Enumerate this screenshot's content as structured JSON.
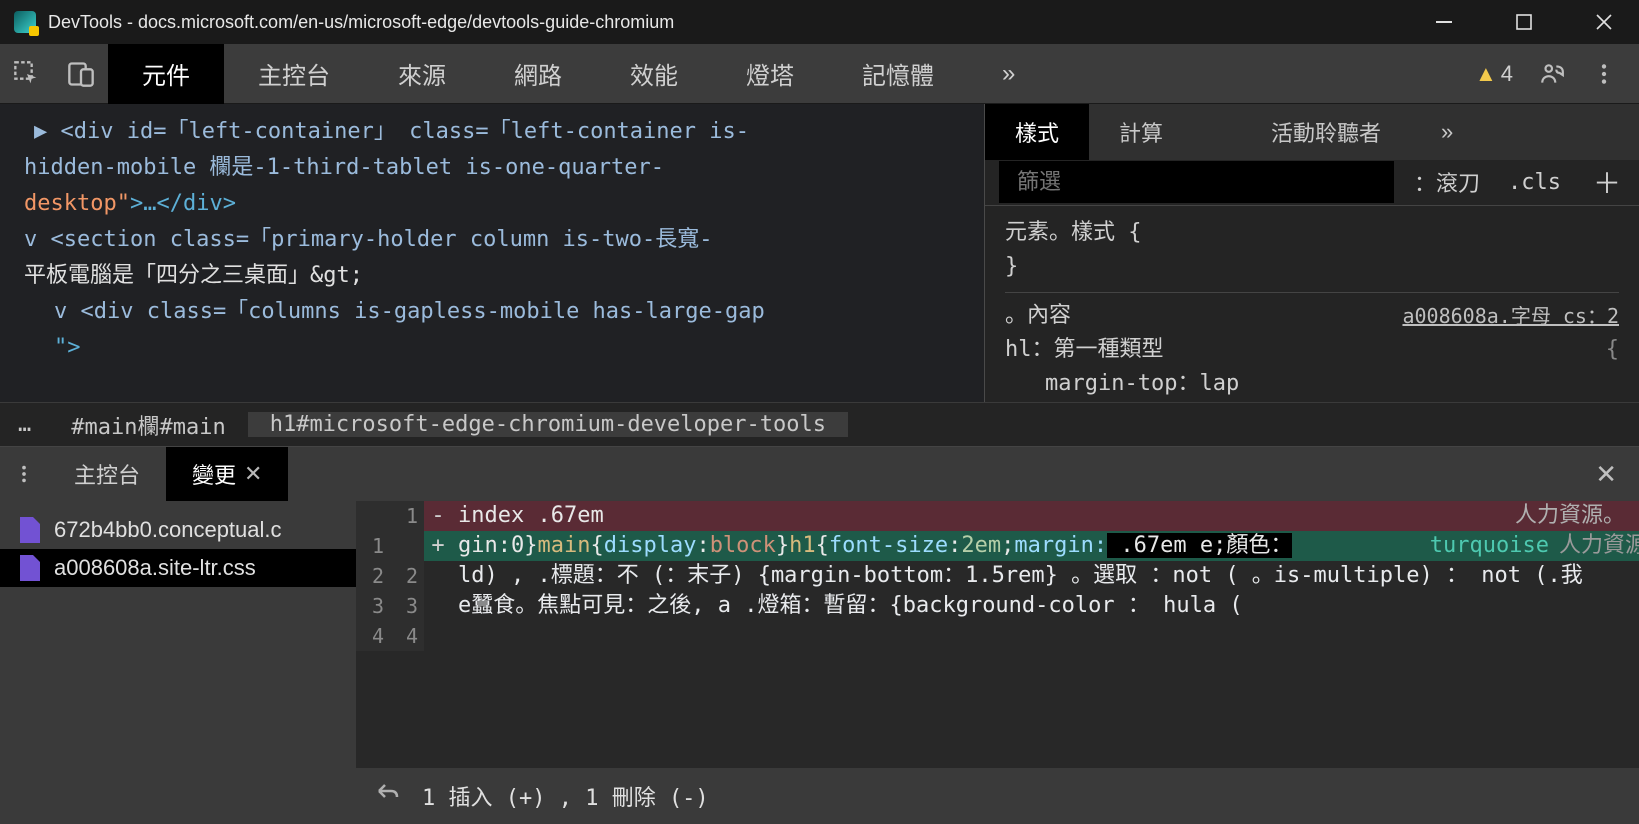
{
  "window": {
    "title": "DevTools - docs.microsoft.com/en-us/microsoft-edge/devtools-guide-chromium"
  },
  "toolbar": {
    "tabs": [
      "元件",
      "主控台",
      "來源",
      "網路",
      "效能",
      "燈塔",
      "記憶體"
    ],
    "more": "»",
    "warning_count": "4"
  },
  "elements": {
    "line1a": "▶ <div id=「left-container」 class=「left-container is-",
    "line1b": "hidden-mobile 欄是-1-third-tablet is-one-quarter-",
    "line1c_val": "desktop\"",
    "line1c_punc": ">…</",
    "line1c_tag": "div",
    "line1c_end": ">",
    "line2a": "v <section class=「primary-holder column is-two-長寬-",
    "line2b": "平板電腦是「四分之三桌面」&gt;",
    "line3a": "v <div class=「columns is-gapless-mobile has-large-gap",
    "line3b": "\">"
  },
  "breadcrumb": {
    "more": "…",
    "item1": "#main欄#main",
    "item2": "h1#microsoft-edge-chromium-developer-tools"
  },
  "styles": {
    "tabs": [
      "樣式",
      "計算",
      "活動聆聽者"
    ],
    "more": "»",
    "filter_placeholder": "篩選",
    "hov": "：滾刀",
    "cls": ".cls",
    "rule1_sel": "元素。樣式 {",
    "rule1_close": "}",
    "rule2_sel": "。內容",
    "rule2_link": "a008608a.字母 cs：2",
    "rule3_sel": "hl：第一種類型",
    "rule3_brace": "{",
    "rule3_prop": "margin-top：lap"
  },
  "drawer": {
    "tabs": [
      "主控台",
      "變更"
    ],
    "files": [
      "672b4bb0.conceptual.c",
      "a008608a.site-ltr.css"
    ],
    "footer": "1 插入 (+) , 1 刪除 (-)",
    "diff": {
      "r1": {
        "ol": "",
        "nl": "1",
        "m": "-",
        "t": "index .67em",
        "extra": "人力資源。"
      },
      "r2": {
        "ol": "1",
        "nl": "",
        "m": "+",
        "t1": "gin:0}",
        "t2": "main",
        "t3": "{",
        "t4": "display",
        "t5": ":",
        "t6": "block",
        "t7": "}",
        "t8": "h1",
        "t9": "{",
        "t10": "font-size",
        "t11": ":",
        "t12": "2em",
        "t13": ";",
        "t14": "margin:",
        "tail": " .67em e;顏色：",
        "extra": "turquoise",
        "extra2": "人力資源。"
      },
      "r3": {
        "ol": "2",
        "nl": "2",
        "t": "ld) ,   .標題：不 (：末子) {margin-bottom：1.5rem} 。選取  ：not (  。is-multiple)  ： not (.我"
      },
      "r4": {
        "ol": "3",
        "nl": "3",
        "t": "e蠶食。焦點可見：之後, a .燈箱：暫留：{background-color ： hula ("
      },
      "r5": {
        "ol": "4",
        "nl": "4",
        "t": ""
      }
    }
  }
}
